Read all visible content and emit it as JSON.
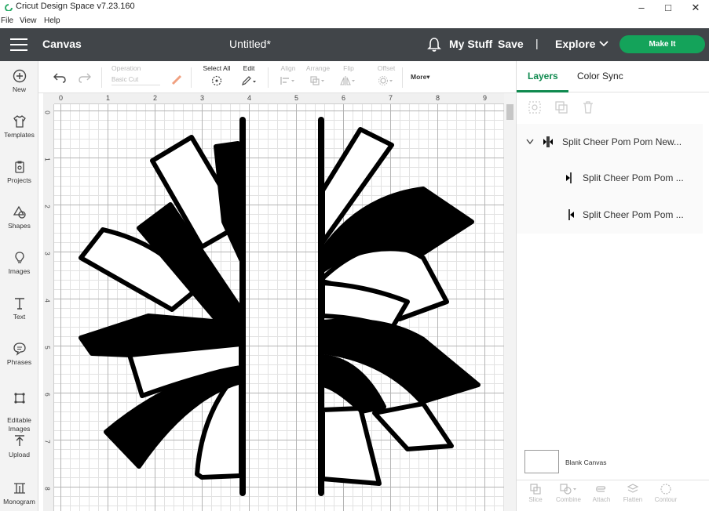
{
  "window": {
    "title": "Cricut Design Space  v7.23.160",
    "controls": [
      "–",
      "□",
      "✕"
    ]
  },
  "menu": [
    "File",
    "View",
    "Help"
  ],
  "header": {
    "section": "Canvas",
    "doc_title": "Untitled*",
    "my_stuff": "My Stuff",
    "save": "Save",
    "separator": "|",
    "explore": "Explore",
    "make_it": "Make It",
    "accent_color": "#14a35a"
  },
  "rail": [
    {
      "label": "New",
      "icon": "plus-circle-icon"
    },
    {
      "label": "Templates",
      "icon": "shirt-icon"
    },
    {
      "label": "Projects",
      "icon": "clipboard-icon"
    },
    {
      "label": "Shapes",
      "icon": "shapes-icon"
    },
    {
      "label": "Images",
      "icon": "bulb-icon"
    },
    {
      "label": "Text",
      "icon": "text-icon"
    },
    {
      "label": "Phrases",
      "icon": "speech-bubble-icon"
    },
    {
      "label": "Editable\nImages",
      "icon": "editable-image-icon"
    },
    {
      "label": "Upload",
      "icon": "upload-icon"
    },
    {
      "label": "Monogram",
      "icon": "monogram-icon"
    }
  ],
  "toolbar": {
    "operation_label": "Operation",
    "operation_value": "Basic Cut",
    "select_all": "Select All",
    "edit": "Edit",
    "align": "Align",
    "arrange": "Arrange",
    "flip": "Flip",
    "offset": "Offset",
    "more": "More▾"
  },
  "ruler": {
    "top": [
      "0",
      "1",
      "2",
      "3",
      "4",
      "5",
      "6",
      "7",
      "8",
      "9"
    ],
    "left": [
      "0",
      "1",
      "2",
      "3",
      "4",
      "5",
      "6",
      "7",
      "8"
    ]
  },
  "panel": {
    "tabs": [
      "Layers",
      "Color Sync"
    ],
    "active_tab": "Layers",
    "layers": [
      {
        "name": "Split Cheer Pom Pom New...",
        "level": 0
      },
      {
        "name": "Split Cheer Pom Pom ...",
        "level": 1
      },
      {
        "name": "Split Cheer Pom Pom ...",
        "level": 1
      }
    ],
    "blank_canvas": "Blank Canvas",
    "bottom_tools": [
      "Slice",
      "Combine",
      "Attach",
      "Flatten",
      "Contour"
    ]
  }
}
